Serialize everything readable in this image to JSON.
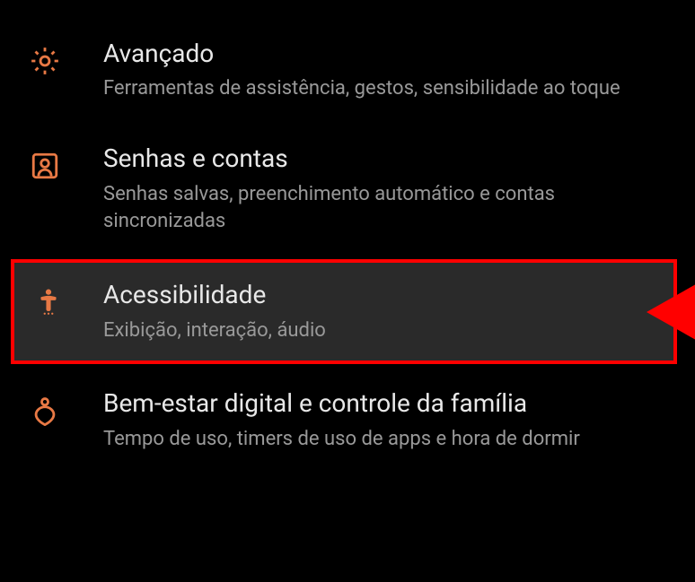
{
  "settings": {
    "items": [
      {
        "title": "Avançado",
        "subtitle": "Ferramentas de assistência, gestos, sensibilidade ao toque",
        "icon": "gear-icon"
      },
      {
        "title": "Senhas e contas",
        "subtitle": "Senhas salvas, preenchimento automático e contas sincronizadas",
        "icon": "account-icon"
      },
      {
        "title": "Acessibilidade",
        "subtitle": "Exibição, interação, áudio",
        "icon": "accessibility-icon",
        "highlighted": true
      },
      {
        "title": "Bem-estar digital e controle da família",
        "subtitle": "Tempo de uso, timers de uso de apps e hora de dormir",
        "icon": "wellbeing-icon"
      }
    ]
  },
  "accent_color": "#e87945"
}
